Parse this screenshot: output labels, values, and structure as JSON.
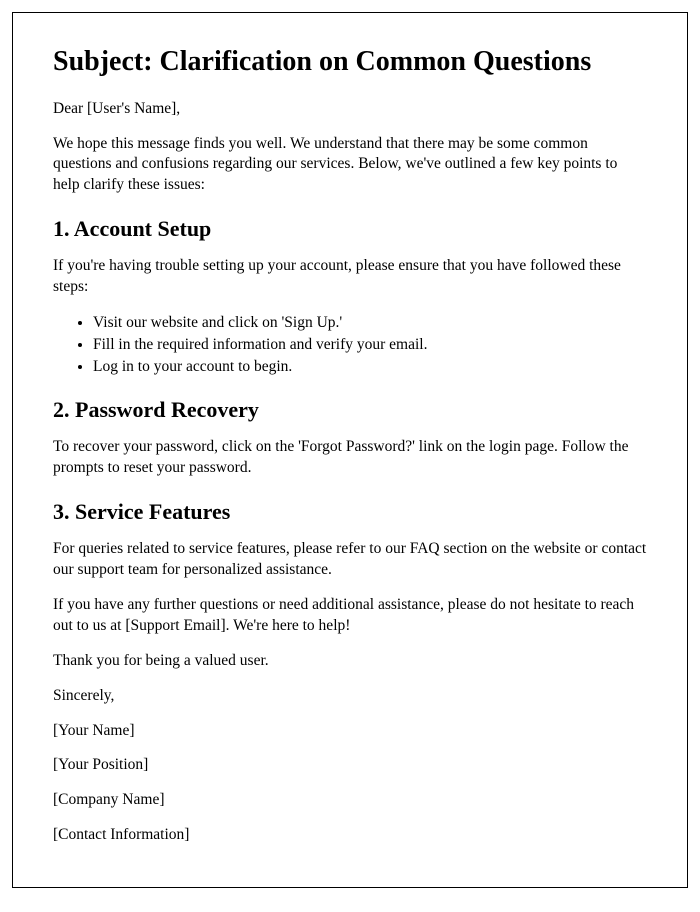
{
  "title": "Subject: Clarification on Common Questions",
  "greeting": "Dear [User's Name],",
  "intro": "We hope this message finds you well. We understand that there may be some common questions and confusions regarding our services. Below, we've outlined a few key points to help clarify these issues:",
  "sections": [
    {
      "heading": "1. Account Setup",
      "body": "If you're having trouble setting up your account, please ensure that you have followed these steps:",
      "items": [
        "Visit our website and click on 'Sign Up.'",
        "Fill in the required information and verify your email.",
        "Log in to your account to begin."
      ]
    },
    {
      "heading": "2. Password Recovery",
      "body": "To recover your password, click on the 'Forgot Password?' link on the login page. Follow the prompts to reset your password."
    },
    {
      "heading": "3. Service Features",
      "body": "For queries related to service features, please refer to our FAQ section on the website or contact our support team for personalized assistance."
    }
  ],
  "closing1": "If you have any further questions or need additional assistance, please do not hesitate to reach out to us at [Support Email]. We're here to help!",
  "closing2": "Thank you for being a valued user.",
  "signoff": "Sincerely,",
  "signature": [
    "[Your Name]",
    "[Your Position]",
    "[Company Name]",
    "[Contact Information]"
  ]
}
